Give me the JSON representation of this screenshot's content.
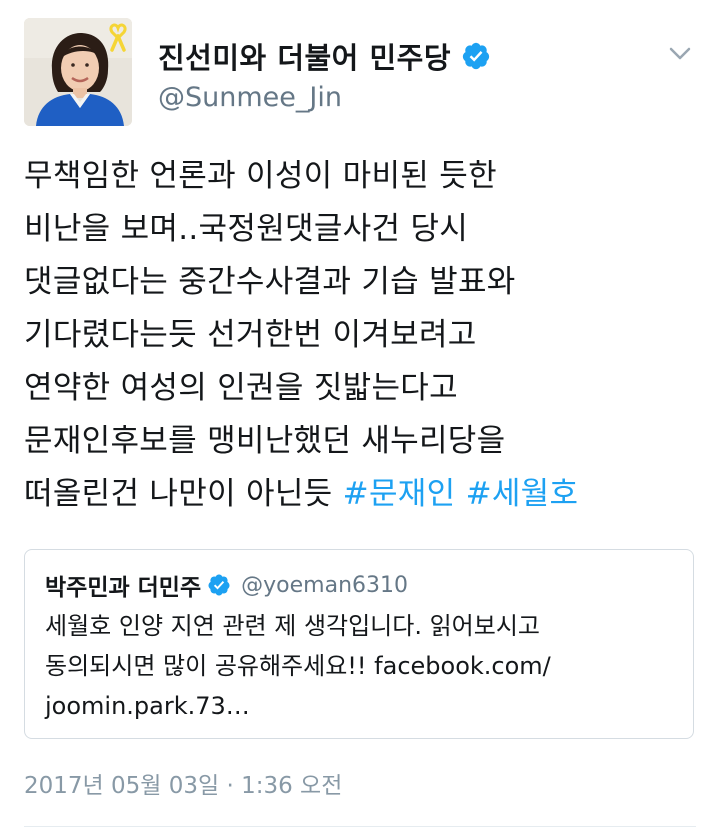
{
  "author": {
    "display_name": "진선미와 더불어 민주당",
    "handle": "@Sunmee_Jin"
  },
  "tweet": {
    "lines": [
      {
        "text": "무책임한 언론과 이성이 마비된 듯한"
      },
      {
        "text": "비난을 보며..국정원댓글사건 당시"
      },
      {
        "text": "댓글없다는 중간수사결과 기습 발표와"
      },
      {
        "text": "기다렸다는듯 선거한번 이겨보려고"
      },
      {
        "text": "연약한 여성의 인권을 짓밟는다고"
      },
      {
        "text": "문재인후보를 맹비난했던 새누리당을"
      },
      {
        "text": "떠올린건 나만이 아닌듯 ",
        "hashtag_1": "#문재인",
        "hashtag_2": "#세월호"
      }
    ]
  },
  "quoted_tweet": {
    "display_name": "박주민과 더민주",
    "handle": "@yoeman6310",
    "lines": [
      "세월호 인양 지연 관련 제 생각입니다. 읽어보시고",
      "동의되시면 많이 공유해주세요!! facebook.com/",
      "joomin.park.73…"
    ]
  },
  "timestamp": "2017년 05월 03일 · 1:36 오전",
  "icons": {
    "verified": "verified-badge-icon",
    "menu": "chevron-down-icon",
    "ribbon": "yellow-ribbon-icon"
  },
  "colors": {
    "link": "#1da1f2",
    "verified": "#1da1f2",
    "secondary_text": "#657786",
    "timestamp_text": "#8899a6",
    "ribbon": "#f5d536"
  }
}
